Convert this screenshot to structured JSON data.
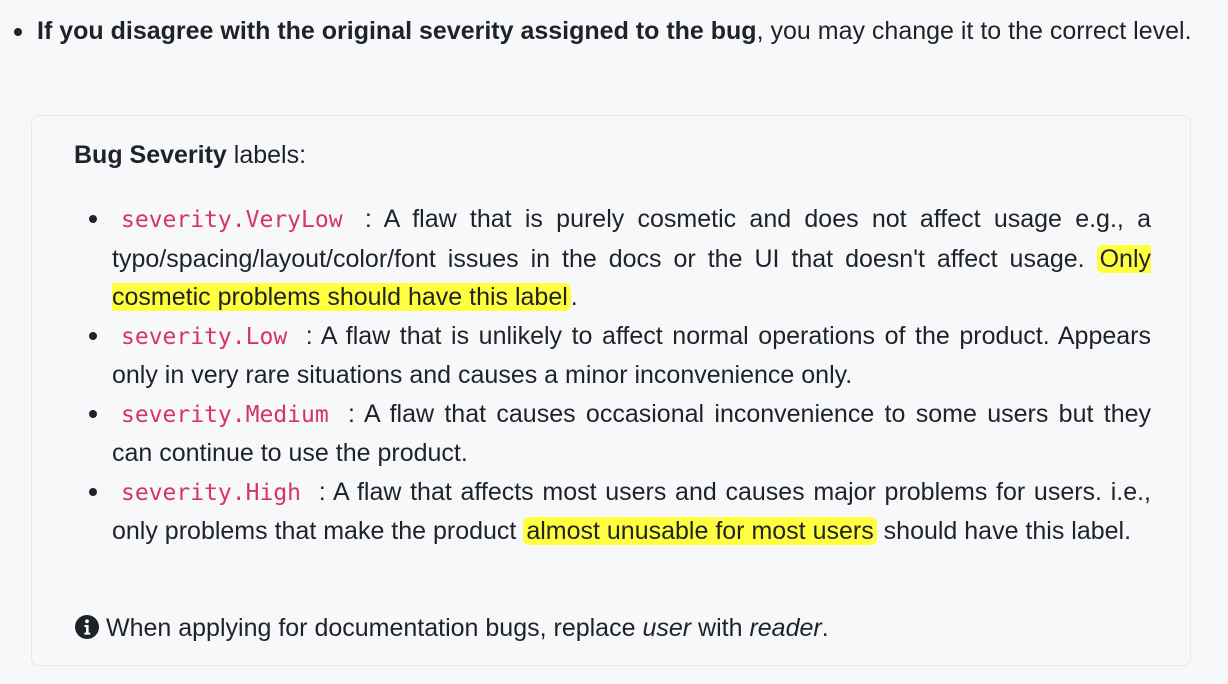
{
  "intro": {
    "bold_text": "If you disagree with the original severity assigned to the bug",
    "rest_text": ", you may change it to the correct level."
  },
  "panel": {
    "heading_bold": "Bug Severity",
    "heading_rest": " labels:",
    "items": [
      {
        "code": "severity.VeryLow",
        "text": " : A flaw that is purely cosmetic and does not affect usage e.g., a typo/spacing/layout/color/font issues in the docs or the UI that doesn't affect usage. ",
        "highlight": "Only cosmetic problems should have this label",
        "after": "."
      },
      {
        "code": "severity.Low",
        "text": " : A flaw that is unlikely to affect normal operations of the product. Appears only in very rare situations and causes a minor inconvenience only."
      },
      {
        "code": "severity.Medium",
        "text": " : A flaw that causes occasional inconvenience to some users but they can continue to use the product."
      },
      {
        "code": "severity.High",
        "text": " : A flaw that affects most users and causes major problems for users. i.e., only problems that make the product ",
        "highlight": "almost unusable for most users",
        "after": " should have this label."
      }
    ],
    "note": {
      "icon": "info-circle-icon",
      "text_before": "When applying for documentation bugs, replace ",
      "em1": "user",
      "text_middle": " with ",
      "em2": "reader",
      "text_after": "."
    }
  },
  "colors": {
    "code": "#d6336c",
    "highlight": "#ffff3f",
    "panel_background": "#f6f8fa"
  }
}
